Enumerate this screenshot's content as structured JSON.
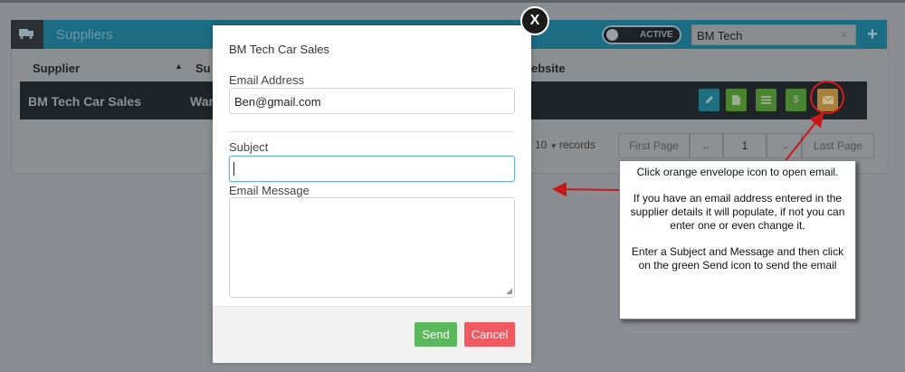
{
  "header": {
    "title": "Suppliers",
    "toggle_label": "ACTIVE",
    "search_value": "BM Tech",
    "search_clear": "×",
    "add_label": "+"
  },
  "table": {
    "columns": [
      "Supplier",
      "Su",
      "ebsite"
    ],
    "row": {
      "supplier": "BM Tech Car Sales",
      "contact": "War"
    },
    "actions": {
      "dollar": "$"
    }
  },
  "pagination": {
    "page_size": "10",
    "records_label": "records",
    "first": "First Page",
    "prev": "←",
    "page": "1",
    "next": "→",
    "last": "Last Page"
  },
  "modal": {
    "title": "BM Tech Car Sales",
    "email_label": "Email Address",
    "email_value": "Ben@gmail.com",
    "subject_label": "Subject",
    "subject_value": "",
    "message_label": "Email Message",
    "message_value": "",
    "send": "Send",
    "cancel": "Cancel",
    "close": "X"
  },
  "callout": {
    "para1": "Click orange envelope icon to open email.",
    "para2": "If you have an email address entered in the supplier details it will populate, if not you can enter one or even change it.",
    "para3": "Enter a Subject and Message and then click on the green Send icon to send the email"
  },
  "colors": {
    "header_bg": "#1c6c84",
    "send_green": "#5cb85c",
    "cancel_red": "#ee5a5f",
    "annotation_red": "#d81b1b"
  }
}
